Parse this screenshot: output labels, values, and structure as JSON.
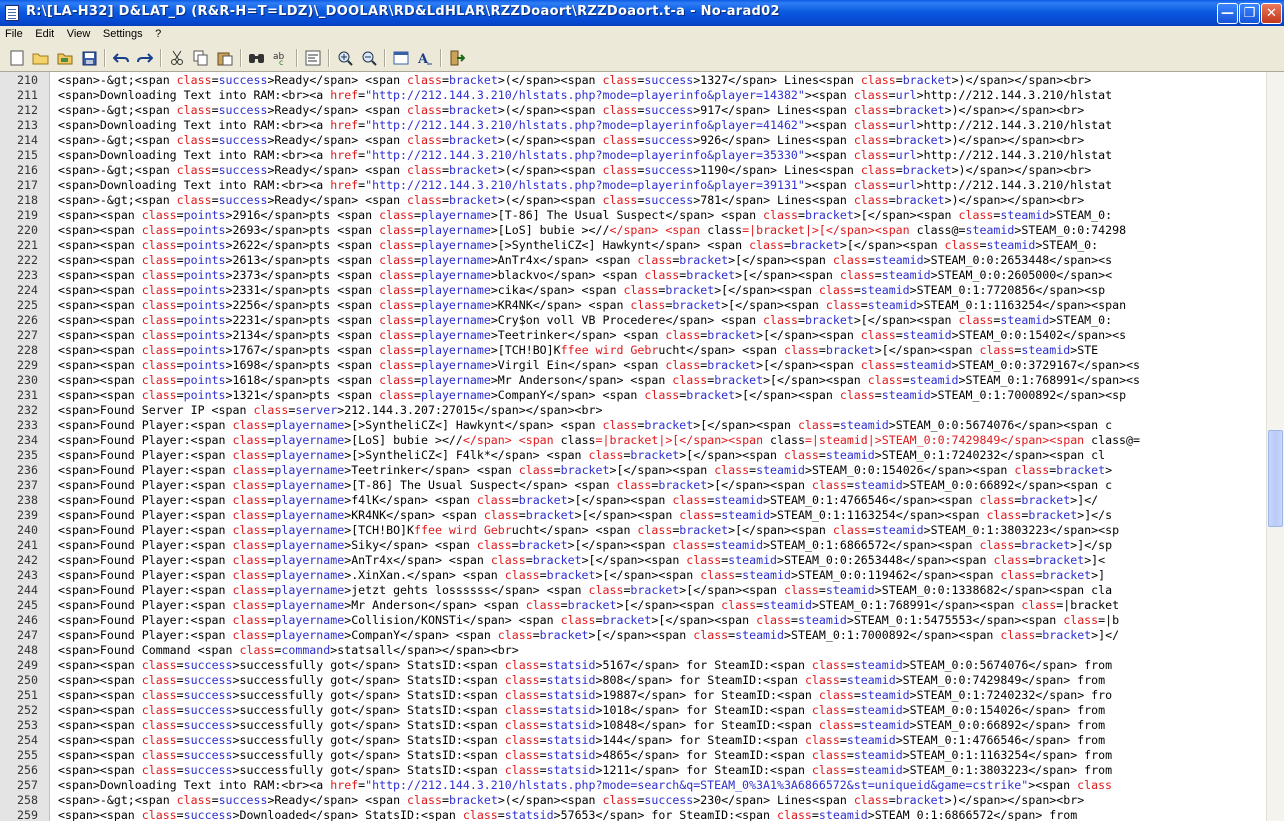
{
  "window": {
    "title": "R:\\[LA-H32] D&LAT_D (R&R-H=T=LDZ)\\_DOOLAR\\RD&LdHLAR\\RZZDoaort\\RZZDoaort.t-a - No-arad02"
  },
  "menu": [
    "File",
    "Edit",
    "View",
    "Settings",
    "?"
  ],
  "toolbar_icons": [
    "new-icon",
    "open-icon",
    "reload-icon",
    "save-icon",
    "undo-icon",
    "redo-icon",
    "cut-icon",
    "copy-icon",
    "paste-icon",
    "find-icon",
    "replace-icon",
    "wordwrap-icon",
    "zoom-in-icon",
    "zoom-out-icon",
    "view-icon",
    "font-icon",
    "exit-icon"
  ],
  "colors": {
    "attribute": "#e0191b",
    "value": "#2f2fd0",
    "text": "#000000"
  },
  "lines": [
    {
      "n": "210",
      "t": "<span>-&gt;<span @class@=|success|>Ready</span> <span @class@=|bracket|>(</span><span @class@=|success|>1327</span> Lines<span @class@=|bracket|>)</span></span><br>"
    },
    {
      "n": "211",
      "t": "<span>Downloading Text into RAM:<br><a @href@=|\"http://212.144.3.210/hlstats.php?mode=playerinfo&player=14382\"|><span @class@=|url|>http://212.144.3.210/hlstat"
    },
    {
      "n": "212",
      "t": "<span>-&gt;<span @class@=|success|>Ready</span> <span @class@=|bracket|>(</span><span @class@=|success|>917</span> Lines<span @class@=|bracket|>)</span></span><br>"
    },
    {
      "n": "213",
      "t": "<span>Downloading Text into RAM:<br><a @href@=|\"http://212.144.3.210/hlstats.php?mode=playerinfo&player=41462\"|><span @class@=|url|>http://212.144.3.210/hlstat"
    },
    {
      "n": "214",
      "t": "<span>-&gt;<span @class@=|success|>Ready</span> <span @class@=|bracket|>(</span><span @class@=|success|>926</span> Lines<span @class@=|bracket|>)</span></span><br>"
    },
    {
      "n": "215",
      "t": "<span>Downloading Text into RAM:<br><a @href@=|\"http://212.144.3.210/hlstats.php?mode=playerinfo&player=35330\"|><span @class@=|url|>http://212.144.3.210/hlstat"
    },
    {
      "n": "216",
      "t": "<span>-&gt;<span @class@=|success|>Ready</span> <span @class@=|bracket|>(</span><span @class@=|success|>1190</span> Lines<span @class@=|bracket|>)</span></span><br>"
    },
    {
      "n": "217",
      "t": "<span>Downloading Text into RAM:<br><a @href@=|\"http://212.144.3.210/hlstats.php?mode=playerinfo&player=39131\"|><span @class@=|url|>http://212.144.3.210/hlstat"
    },
    {
      "n": "218",
      "t": "<span>-&gt;<span @class@=|success|>Ready</span> <span @class@=|bracket|>(</span><span @class@=|success|>781</span> Lines<span @class@=|bracket|>)</span></span><br>"
    },
    {
      "n": "219",
      "t": "<span><span @class@=|points|>2916</span>pts <span @class@=|playername|>[T-86] The Usual Suspect</span> <span @class@=|bracket|>[</span><span @class@=|steamid|>STEAM_0:"
    },
    {
      "n": "220",
      "t": "<span><span @class@=|points|>2693</span>pts <span @class@=|playername|>[LoS] bubie ><//@</span> <span @class@=|bracket|>[</span><span @class@=|steamid|>STEAM_0:0:74298"
    },
    {
      "n": "221",
      "t": "<span><span @class@=|points|>2622</span>pts <span @class@=|playername|>[>SyntheliCZ<] Hawkynt</span> <span @class@=|bracket|>[</span><span @class@=|steamid|>STEAM_0:"
    },
    {
      "n": "222",
      "t": "<span><span @class@=|points|>2613</span>pts <span @class@=|playername|>AnTr4x</span> <span @class@=|bracket|>[</span><span @class@=|steamid|>STEAM_0:0:2653448</span><s"
    },
    {
      "n": "223",
      "t": "<span><span @class@=|points|>2373</span>pts <span @class@=|playername|>blackvo</span> <span @class@=|bracket|>[</span><span @class@=|steamid|>STEAM_0:0:2605000</span><"
    },
    {
      "n": "224",
      "t": "<span><span @class@=|points|>2331</span>pts <span @class@=|playername|>cika</span> <span @class@=|bracket|>[</span><span @class@=|steamid|>STEAM_0:1:7720856</span><sp"
    },
    {
      "n": "225",
      "t": "<span><span @class@=|points|>2256</span>pts <span @class@=|playername|>KR4NK</span> <span @class@=|bracket|>[</span><span @class@=|steamid|>STEAM_0:1:1163254</span><span"
    },
    {
      "n": "226",
      "t": "<span><span @class@=|points|>2231</span>pts <span @class@=|playername|>Cry$on voll VB Procedere</span> <span @class@=|bracket|>[</span><span @class@=|steamid|>STEAM_0:"
    },
    {
      "n": "227",
      "t": "<span><span @class@=|points|>2134</span>pts <span @class@=|playername|>Teetrinker</span> <span @class@=|bracket|>[</span><span @class@=|steamid|>STEAM_0:0:15402</span><s"
    },
    {
      "n": "228",
      "t": "<span><span @class@=|points|>1767</span>pts <span @class@=|playername|>[TCH!BO]K@ffee wird Gebr@ucht</span> <span @class@=|bracket|>[</span><span @class@=|steamid|>STE"
    },
    {
      "n": "229",
      "t": "<span><span @class@=|points|>1698</span>pts <span @class@=|playername|>Virgil Ein</span> <span @class@=|bracket|>[</span><span @class@=|steamid|>STEAM_0:0:3729167</span><s"
    },
    {
      "n": "230",
      "t": "<span><span @class@=|points|>1618</span>pts <span @class@=|playername|>Mr Anderson</span> <span @class@=|bracket|>[</span><span @class@=|steamid|>STEAM_0:1:768991</span><s"
    },
    {
      "n": "231",
      "t": "<span><span @class@=|points|>1321</span>pts <span @class@=|playername|>CompanY</span> <span @class@=|bracket|>[</span><span @class@=|steamid|>STEAM_0:1:7000892</span><sp"
    },
    {
      "n": "232",
      "t": "<span>Found Server IP <span @class@=|server|>212.144.3.207:27015</span></span><br>"
    },
    {
      "n": "233",
      "t": "<span>Found Player:<span @class@=|playername|>[>SyntheliCZ<] Hawkynt</span> <span @class@=|bracket|>[</span><span @class@=|steamid|>STEAM_0:0:5674076</span><span c"
    },
    {
      "n": "234",
      "t": "<span>Found Player:<span @class@=|playername|>[LoS] bubie ><//@</span> <span @class@=|bracket|>[</span><span @class@=|steamid|>STEAM_0:0:7429849</span><span @class@="
    },
    {
      "n": "235",
      "t": "<span>Found Player:<span @class@=|playername|>[>SyntheliCZ<] F4lk*</span> <span @class@=|bracket|>[</span><span @class@=|steamid|>STEAM_0:1:7240232</span><span cl"
    },
    {
      "n": "236",
      "t": "<span>Found Player:<span @class@=|playername|>Teetrinker</span> <span @class@=|bracket|>[</span><span @class@=|steamid|>STEAM_0:0:154026</span><span @class@=|bracket|>"
    },
    {
      "n": "237",
      "t": "<span>Found Player:<span @class@=|playername|>[T-86] The Usual Suspect</span> <span @class@=|bracket|>[</span><span @class@=|steamid|>STEAM_0:0:66892</span><span c"
    },
    {
      "n": "238",
      "t": "<span>Found Player:<span @class@=|playername|>f4lK</span> <span @class@=|bracket|>[</span><span @class@=|steamid|>STEAM_0:1:4766546</span><span @class@=|bracket|>]</"
    },
    {
      "n": "239",
      "t": "<span>Found Player:<span @class@=|playername|>KR4NK</span> <span @class@=|bracket|>[</span><span @class@=|steamid|>STEAM_0:1:1163254</span><span @class@=|bracket|>]</s"
    },
    {
      "n": "240",
      "t": "<span>Found Player:<span @class@=|playername|>[TCH!BO]K@ffee wird Gebr@ucht</span> <span @class@=|bracket|>[</span><span @class@=|steamid|>STEAM_0:1:3803223</span><sp"
    },
    {
      "n": "241",
      "t": "<span>Found Player:<span @class@=|playername|>Siky</span> <span @class@=|bracket|>[</span><span @class@=|steamid|>STEAM_0:1:6866572</span><span @class@=|bracket|>]</sp"
    },
    {
      "n": "242",
      "t": "<span>Found Player:<span @class@=|playername|>AnTr4x</span> <span @class@=|bracket|>[</span><span @class@=|steamid|>STEAM_0:0:2653448</span><span @class@=|bracket|>]<"
    },
    {
      "n": "243",
      "t": "<span>Found Player:<span @class@=|playername|>.XinXan.</span> <span @class@=|bracket|>[</span><span @class@=|steamid|>STEAM_0:0:119462</span><span @class@=|bracket|>]"
    },
    {
      "n": "244",
      "t": "<span>Found Player:<span @class@=|playername|>jetzt gehts lossssss</span> <span @class@=|bracket|>[</span><span @class@=|steamid|>STEAM_0:0:1338682</span><span cla"
    },
    {
      "n": "245",
      "t": "<span>Found Player:<span @class@=|playername|>Mr Anderson</span> <span @class@=|bracket|>[</span><span @class@=|steamid|>STEAM_0:1:768991</span><span @class@=|bracket"
    },
    {
      "n": "246",
      "t": "<span>Found Player:<span @class@=|playername|>Collision/KONSTi</span> <span @class@=|bracket|>[</span><span @class@=|steamid|>STEAM_0:1:5475553</span><span @class@=|b"
    },
    {
      "n": "247",
      "t": "<span>Found Player:<span @class@=|playername|>CompanY</span> <span @class@=|bracket|>[</span><span @class@=|steamid|>STEAM_0:1:7000892</span><span @class@=|bracket|>]</"
    },
    {
      "n": "248",
      "t": "<span>Found Command <span @class@=|command|>statsall</span></span><br>"
    },
    {
      "n": "249",
      "t": "<span><span @class@=|success|>successfully got</span> StatsID:<span @class@=|statsid|>5167</span> for SteamID:<span @class@=|steamid|>STEAM_0:0:5674076</span> from"
    },
    {
      "n": "250",
      "t": "<span><span @class@=|success|>successfully got</span> StatsID:<span @class@=|statsid|>808</span> for SteamID:<span @class@=|steamid|>STEAM_0:0:7429849</span> from"
    },
    {
      "n": "251",
      "t": "<span><span @class@=|success|>successfully got</span> StatsID:<span @class@=|statsid|>19887</span> for SteamID:<span @class@=|steamid|>STEAM_0:1:7240232</span> fro"
    },
    {
      "n": "252",
      "t": "<span><span @class@=|success|>successfully got</span> StatsID:<span @class@=|statsid|>1018</span> for SteamID:<span @class@=|steamid|>STEAM_0:0:154026</span> from"
    },
    {
      "n": "253",
      "t": "<span><span @class@=|success|>successfully got</span> StatsID:<span @class@=|statsid|>10848</span> for SteamID:<span @class@=|steamid|>STEAM_0:0:66892</span> from"
    },
    {
      "n": "254",
      "t": "<span><span @class@=|success|>successfully got</span> StatsID:<span @class@=|statsid|>144</span> for SteamID:<span @class@=|steamid|>STEAM_0:1:4766546</span> from"
    },
    {
      "n": "255",
      "t": "<span><span @class@=|success|>successfully got</span> StatsID:<span @class@=|statsid|>4865</span> for SteamID:<span @class@=|steamid|>STEAM_0:1:1163254</span> from"
    },
    {
      "n": "256",
      "t": "<span><span @class@=|success|>successfully got</span> StatsID:<span @class@=|statsid|>1211</span> for SteamID:<span @class@=|steamid|>STEAM_0:1:3803223</span> from"
    },
    {
      "n": "257",
      "t": "<span>Downloading Text into RAM:<br><a @href@=|\"http://212.144.3.210/hlstats.php?mode=search&q=STEAM_0%3A1%3A6866572&st=uniqueid&game=cstrike\"|><span @class@"
    },
    {
      "n": "258",
      "t": "<span>-&gt;<span @class@=|success|>Ready</span> <span @class@=|bracket|>(</span><span @class@=|success|>230</span> Lines<span @class@=|bracket|>)</span></span><br>"
    },
    {
      "n": "259",
      "t": "<span><span @class@=|success|>Downloaded</span> StatsID:<span @class@=|statsid|>57653</span> for SteamID:<span @class@=|steamid|>STEAM_0:1:6866572</span> from"
    }
  ]
}
